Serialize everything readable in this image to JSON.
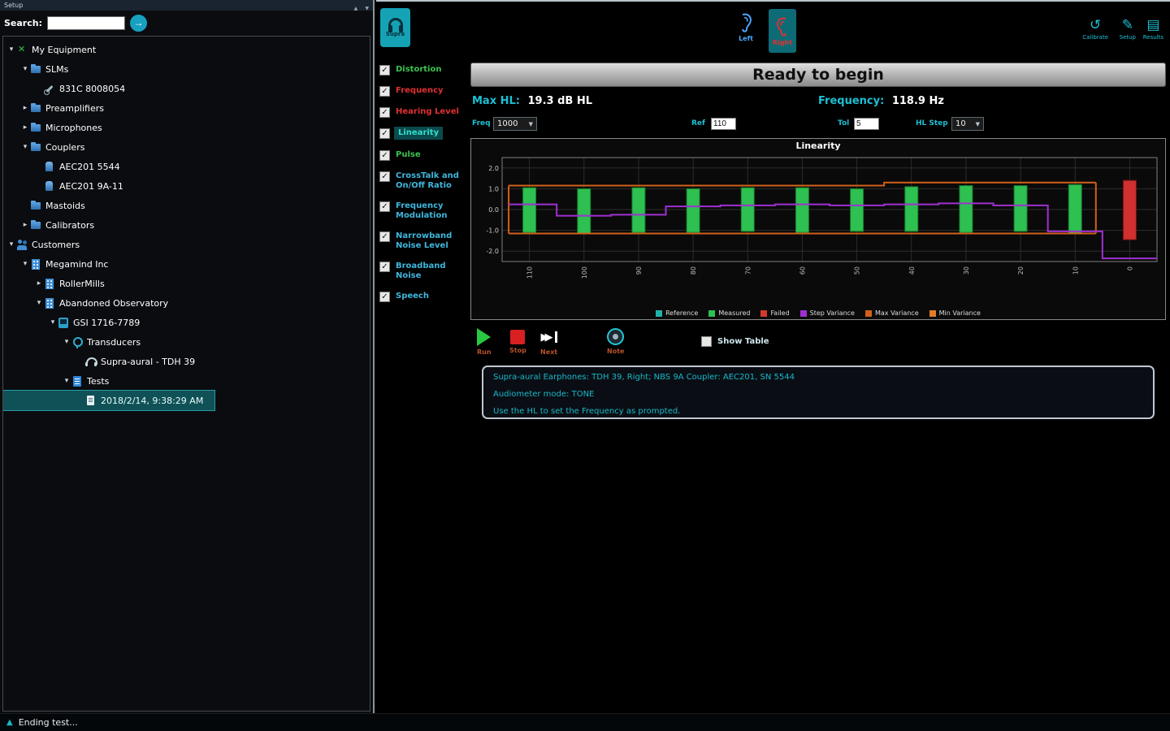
{
  "window": {
    "titlebar": "Setup",
    "status_text": "Ending test..."
  },
  "sidebar": {
    "search_label": "Search:",
    "search_value": "",
    "tree": [
      {
        "label": "My Equipment",
        "depth": 0,
        "expander": "open",
        "icon": "equipment-icon"
      },
      {
        "label": "SLMs",
        "depth": 1,
        "expander": "open",
        "icon": "folder-icon"
      },
      {
        "label": "831C 8008054",
        "depth": 2,
        "expander": "none",
        "icon": "wrench-icon"
      },
      {
        "label": "Preamplifiers",
        "depth": 1,
        "expander": "closed",
        "icon": "folder-icon"
      },
      {
        "label": "Microphones",
        "depth": 1,
        "expander": "closed",
        "icon": "folder-icon"
      },
      {
        "label": "Couplers",
        "depth": 1,
        "expander": "open",
        "icon": "folder-icon"
      },
      {
        "label": "AEC201 5544",
        "depth": 2,
        "expander": "none",
        "icon": "coupler-icon"
      },
      {
        "label": "AEC201 9A-11",
        "depth": 2,
        "expander": "none",
        "icon": "coupler-icon"
      },
      {
        "label": "Mastoids",
        "depth": 1,
        "expander": "none",
        "icon": "folder-icon"
      },
      {
        "label": "Calibrators",
        "depth": 1,
        "expander": "closed",
        "icon": "folder-icon"
      },
      {
        "label": "Customers",
        "depth": 0,
        "expander": "open",
        "icon": "customers-icon"
      },
      {
        "label": "Megamind Inc",
        "depth": 1,
        "expander": "open",
        "icon": "building-icon"
      },
      {
        "label": "RollerMills",
        "depth": 2,
        "expander": "closed",
        "icon": "building-icon"
      },
      {
        "label": "Abandoned Observatory",
        "depth": 2,
        "expander": "open",
        "icon": "building-icon"
      },
      {
        "label": "GSI 1716-7789",
        "depth": 3,
        "expander": "open",
        "icon": "device-icon"
      },
      {
        "label": "Transducers",
        "depth": 4,
        "expander": "open",
        "icon": "transducer-icon"
      },
      {
        "label": "Supra-aural - TDH 39",
        "depth": 5,
        "expander": "none",
        "icon": "headphone-icon"
      },
      {
        "label": "Tests",
        "depth": 4,
        "expander": "open",
        "icon": "tests-icon"
      },
      {
        "label": "2018/2/14, 9:38:29 AM",
        "depth": 5,
        "expander": "none",
        "icon": "doc-icon",
        "selected": true
      }
    ]
  },
  "toolbar": {
    "transducer_button": {
      "label": "Supra"
    },
    "left_ear": {
      "label": "Left"
    },
    "right_ear": {
      "label": "Right",
      "selected": true
    },
    "calibrate_label": "Calibrate",
    "setup_label": "Setup",
    "results_label": "Results"
  },
  "test_list": [
    {
      "label": "Distortion",
      "state": "passed"
    },
    {
      "label": "Frequency",
      "state": "failed"
    },
    {
      "label": "Hearing Level",
      "state": "failed"
    },
    {
      "label": "Linearity",
      "state": "active"
    },
    {
      "label": "Pulse",
      "state": "passed"
    },
    {
      "label": "CrossTalk and On/Off Ratio",
      "state": "pending"
    },
    {
      "label": "Frequency Modulation",
      "state": "pending"
    },
    {
      "label": "Narrowband Noise Level",
      "state": "pending"
    },
    {
      "label": "Broadband Noise",
      "state": "pending"
    },
    {
      "label": "Speech",
      "state": "pending"
    }
  ],
  "main": {
    "status_banner": "Ready to begin",
    "max_hl_label": "Max HL:",
    "max_hl_value": "19.3 dB HL",
    "frequency_label": "Frequency:",
    "frequency_value": "118.9 Hz",
    "controls": {
      "freq_label": "Freq",
      "freq_value": "1000",
      "ref_label": "Ref",
      "ref_value": "110",
      "tol_label": "Tol",
      "tol_value": "5",
      "hl_step_label": "HL Step",
      "hl_step_value": "10"
    },
    "transport": {
      "run": "Run",
      "stop": "Stop",
      "next": "Next",
      "note": "Note",
      "show_table": "Show Table"
    },
    "info_lines": [
      "Supra-aural Earphones: TDH 39, Right; NBS 9A Coupler: AEC201, SN 5544",
      "Audiometer mode: TONE",
      "Use the HL to set the Frequency as prompted."
    ]
  },
  "chart_data": {
    "type": "bar",
    "title": "Linearity",
    "ylim": [
      -2.5,
      2.5
    ],
    "yticks": [
      2,
      1,
      0,
      -1,
      -2
    ],
    "x_labels": [
      "110",
      "100",
      "90",
      "80",
      "70",
      "60",
      "50",
      "40",
      "30",
      "20",
      "10",
      "0"
    ],
    "bars": [
      {
        "lo": -1.1,
        "hi": 1.05,
        "status": "pass"
      },
      {
        "lo": -1.15,
        "hi": 1.0,
        "status": "pass"
      },
      {
        "lo": -1.1,
        "hi": 1.05,
        "status": "pass"
      },
      {
        "lo": -1.1,
        "hi": 1.0,
        "status": "pass"
      },
      {
        "lo": -1.05,
        "hi": 1.05,
        "status": "pass"
      },
      {
        "lo": -1.1,
        "hi": 1.05,
        "status": "pass"
      },
      {
        "lo": -1.05,
        "hi": 1.0,
        "status": "pass"
      },
      {
        "lo": -1.05,
        "hi": 1.1,
        "status": "pass"
      },
      {
        "lo": -1.1,
        "hi": 1.15,
        "status": "pass"
      },
      {
        "lo": -1.05,
        "hi": 1.15,
        "status": "pass"
      },
      {
        "lo": -1.15,
        "hi": 1.2,
        "status": "pass"
      },
      {
        "lo": -1.45,
        "hi": 1.4,
        "status": "fail"
      }
    ],
    "step_variance": [
      0.25,
      -0.3,
      -0.25,
      0.15,
      0.2,
      0.25,
      0.2,
      0.25,
      0.3,
      0.2,
      -1.05
    ],
    "step_variance_tail": -2.35,
    "max_variance": [
      1.15,
      1.15,
      1.15,
      1.15,
      1.15,
      1.15,
      1.15,
      1.3,
      1.3,
      1.3,
      1.3
    ],
    "min_variance": [
      -1.15,
      -1.15,
      -1.15,
      -1.15,
      -1.15,
      -1.15,
      -1.15,
      -1.15,
      -1.15,
      -1.15,
      -1.15
    ],
    "legend": [
      {
        "label": "Reference",
        "color": "#20b2aa"
      },
      {
        "label": "Measured",
        "color": "#2ec050"
      },
      {
        "label": "Failed",
        "color": "#d43a2a"
      },
      {
        "label": "Step Variance",
        "color": "#a030d0"
      },
      {
        "label": "Max Variance",
        "color": "#d2601a"
      },
      {
        "label": "Min Variance",
        "color": "#e07b28"
      }
    ]
  },
  "colors": {
    "accent": "#18b8c8",
    "passed": "#3cc24e",
    "failed": "#e03030",
    "pending": "#3fb6dc",
    "bar_green": "#2ec050",
    "bar_red": "#d03030",
    "step": "#a030d0",
    "variance": "#d2601a"
  }
}
